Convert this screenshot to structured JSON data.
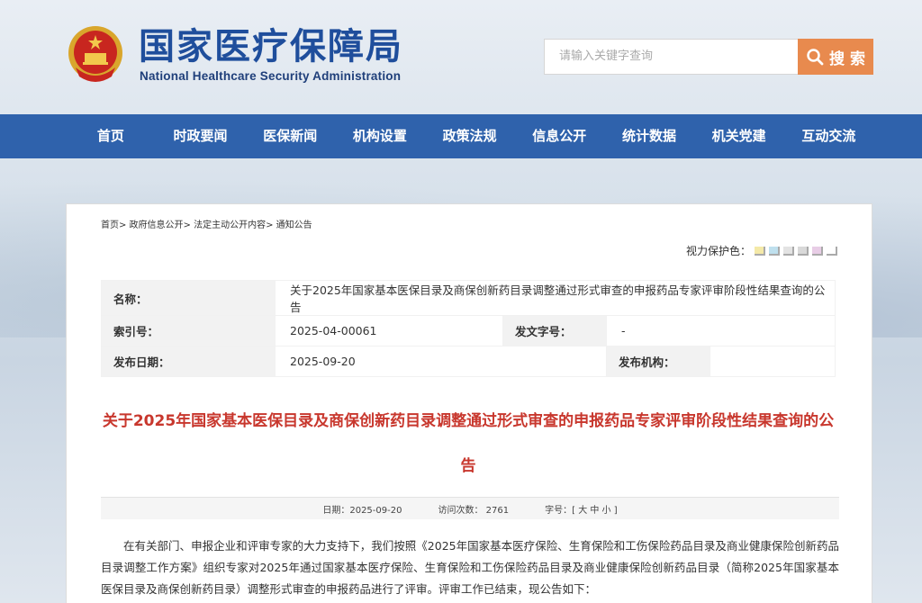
{
  "header": {
    "logo_cn": "国家医疗保障局",
    "logo_en": "National Healthcare Security Administration",
    "search_placeholder": "请输入关键字查询",
    "search_button": "搜 索"
  },
  "nav": [
    "首页",
    "时政要闻",
    "医保新闻",
    "机构设置",
    "政策法规",
    "信息公开",
    "统计数据",
    "机关党建",
    "互动交流"
  ],
  "breadcrumb": "首页> 政府信息公开> 法定主动公开内容> 通知公告",
  "eye_protect": {
    "label": "视力保护色：",
    "colors": [
      "#f4e9a8",
      "#bfe0ee",
      "#e3e3e3",
      "#d9d9d9",
      "#e8cde6",
      "#ffffff"
    ]
  },
  "meta": {
    "name_label": "名称：",
    "name_value": "关于2025年国家基本医保目录及商保创新药目录调整通过形式审查的申报药品专家评审阶段性结果查询的公告",
    "index_label": "索引号：",
    "index_value": "2025-04-00061",
    "doc_no_label": "发文字号：",
    "doc_no_value": "-",
    "date_label": "发布日期：",
    "date_value": "2025-09-20",
    "org_label": "发布机构：",
    "org_value": ""
  },
  "article": {
    "title": "关于2025年国家基本医保目录及商保创新药目录调整通过形式审查的申报药品专家评审阶段性结果查询的公告",
    "date_text": "日期：2025-09-20",
    "visits_text": "访问次数：  2761",
    "font_text": "字号：[ 大 中 小 ]",
    "paragraph": "在有关部门、申报企业和评审专家的大力支持下，我们按照《2025年国家基本医疗保险、生育保险和工伤保险药品目录及商业健康保险创新药品目录调整工作方案》组织专家对2025年通过国家基本医疗保险、生育保险和工伤保险药品目录及商业健康保险创新药品目录（简称2025年国家基本医保目录及商保创新药目录）调整形式审查的申报药品进行了评审。评审工作已结束，现公告如下："
  }
}
